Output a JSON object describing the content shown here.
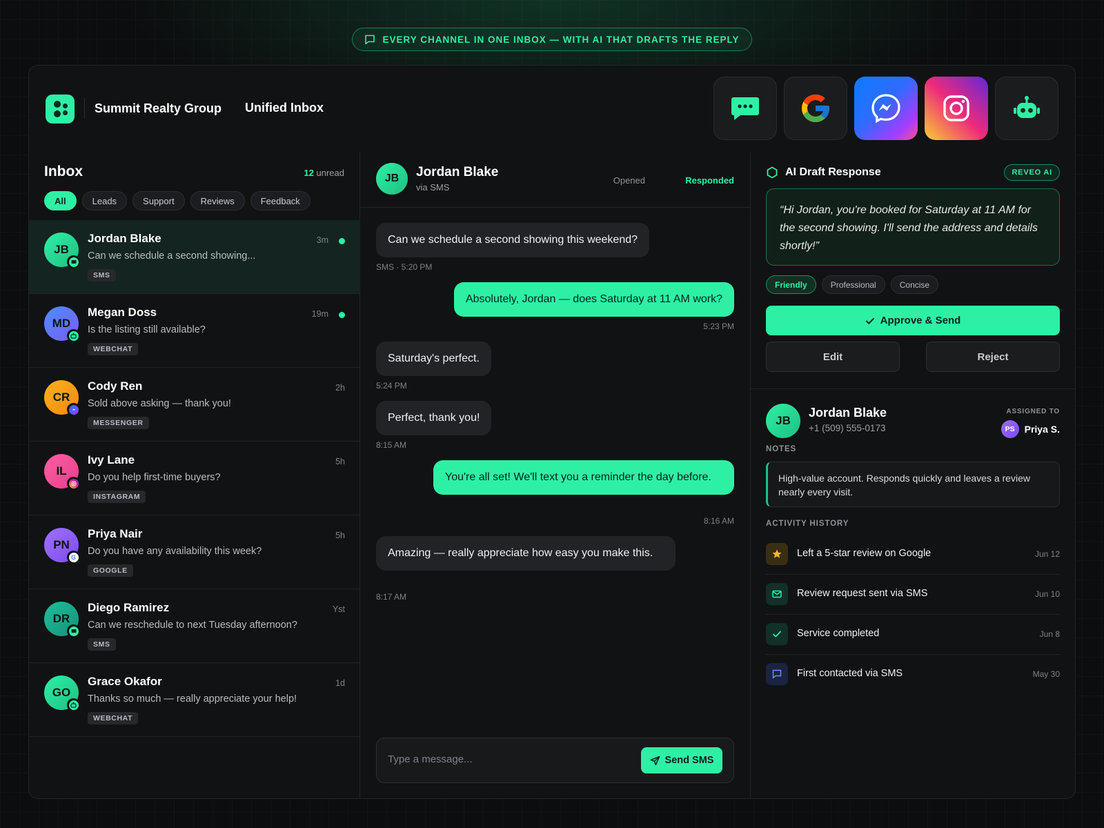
{
  "banner": {
    "text": "EVERY CHANNEL IN ONE INBOX — WITH AI THAT DRAFTS THE REPLY",
    "icon": "chat-bubble-icon"
  },
  "header": {
    "brand": "Summit Realty Group",
    "title": "Unified Inbox",
    "channels": [
      "sms",
      "google",
      "messenger",
      "instagram",
      "ai-bot"
    ]
  },
  "colors": {
    "accent": "#2ef0a5",
    "background": "#111213",
    "panel": "#1b1c1e"
  },
  "inbox": {
    "title": "Inbox",
    "unread_count": "12",
    "unread_label": "unread",
    "filters": [
      "All",
      "Leads",
      "Support",
      "Reviews",
      "Feedback"
    ],
    "active_filter": "All",
    "conversations": [
      {
        "initials": "JB",
        "name": "Jordan Blake",
        "preview": "Can we schedule a second showing...",
        "channel": "SMS",
        "time": "3m",
        "unread": true,
        "selected": true
      },
      {
        "initials": "MD",
        "name": "Megan Doss",
        "preview": "Is the listing still available?",
        "channel": "WEBCHAT",
        "time": "19m",
        "unread": true
      },
      {
        "initials": "CR",
        "name": "Cody Ren",
        "preview": "Sold above asking — thank you!",
        "channel": "MESSENGER",
        "time": "2h",
        "unread": false
      },
      {
        "initials": "IL",
        "name": "Ivy Lane",
        "preview": "Do you help first-time buyers?",
        "channel": "INSTAGRAM",
        "time": "5h",
        "unread": false
      },
      {
        "initials": "PN",
        "name": "Priya Nair",
        "preview": "Do you have any availability this week?",
        "channel": "GOOGLE",
        "time": "5h",
        "unread": false
      },
      {
        "initials": "DR",
        "name": "Diego Ramirez",
        "preview": "Can we reschedule to next Tuesday afternoon?",
        "channel": "SMS",
        "time": "Yst",
        "unread": false
      },
      {
        "initials": "GO",
        "name": "Grace Okafor",
        "preview": "Thanks so much — really appreciate your help!",
        "channel": "WEBCHAT",
        "time": "1d",
        "unread": false
      }
    ]
  },
  "chat": {
    "initials": "JB",
    "name": "Jordan Blake",
    "via": "via SMS",
    "status_opened": "Opened",
    "status_responded": "Responded",
    "messages": [
      {
        "dir": "in",
        "text": "Can we schedule a second showing this weekend?",
        "time": "SMS · 5:20 PM"
      },
      {
        "dir": "out",
        "text": "Absolutely, Jordan — does Saturday at 11 AM work?",
        "time": "5:23 PM"
      },
      {
        "dir": "in",
        "text": "Saturday's perfect.",
        "time": "5:24 PM"
      },
      {
        "dir": "in",
        "text": "Perfect, thank you!",
        "time": "8:15 AM"
      },
      {
        "dir": "out",
        "text": "You're all set! We'll text you a reminder the day before.",
        "time": "8:16 AM"
      },
      {
        "dir": "in",
        "text": "Amazing — really appreciate how easy you make this.",
        "time": "8:17 AM"
      }
    ],
    "composer_placeholder": "Type a message...",
    "send_label": "Send SMS"
  },
  "ai": {
    "title": "AI Draft Response",
    "badge": "REVEO AI",
    "draft": "“Hi Jordan, you're booked for Saturday at 11 AM for the second showing. I'll send the address and details shortly!”",
    "tones": [
      "Friendly",
      "Professional",
      "Concise"
    ],
    "active_tone": "Friendly",
    "approve_label": "Approve & Send",
    "edit_label": "Edit",
    "reject_label": "Reject"
  },
  "contact": {
    "initials": "JB",
    "name": "Jordan Blake",
    "phone": "+1 (509) 555-0173",
    "assigned_label": "ASSIGNED TO",
    "assignee_initials": "PS",
    "assignee": "Priya S.",
    "notes_label": "NOTES",
    "notes": "High-value account. Responds quickly and leaves a review nearly every visit.",
    "activity_label": "ACTIVITY HISTORY",
    "activity": [
      {
        "icon": "star-icon",
        "text": "Left a 5-star review on Google",
        "date": "Jun 12"
      },
      {
        "icon": "mail-icon",
        "text": "Review request sent via SMS",
        "date": "Jun 10"
      },
      {
        "icon": "check-icon",
        "text": "Service completed",
        "date": "Jun 8"
      },
      {
        "icon": "chat-icon",
        "text": "First contacted via SMS",
        "date": "May 30"
      }
    ]
  }
}
